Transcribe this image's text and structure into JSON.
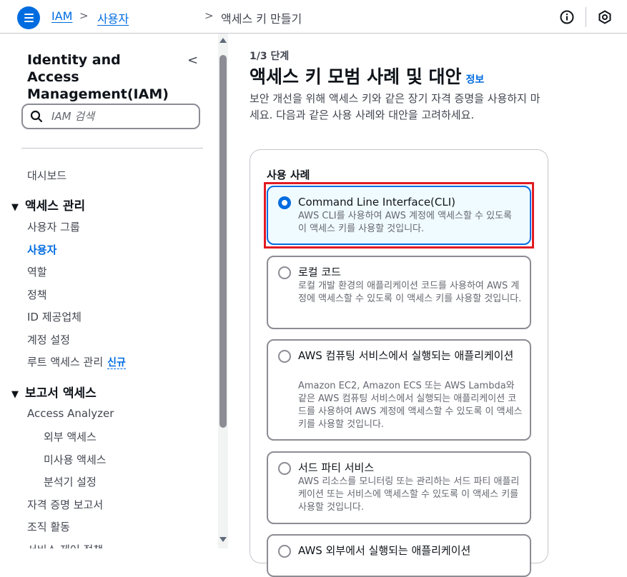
{
  "topbar": {
    "breadcrumbs": [
      {
        "label": "IAM"
      },
      {
        "label": "사용자"
      },
      {
        "label": "액세스 키 만들기"
      }
    ],
    "icons": [
      "menu-icon",
      "info-icon",
      "settings-icon"
    ]
  },
  "sidebar": {
    "title": "Identity and Access Management(IAM)",
    "search_placeholder": "IAM 검색",
    "items": {
      "dashboard": "대시보드",
      "access_mgmt": "액세스 관리",
      "user_groups": "사용자 그룹",
      "users": "사용자",
      "roles": "역할",
      "policies": "정책",
      "id_providers": "ID 제공업체",
      "account_settings": "계정 설정",
      "root_access": "루트 액세스 관리",
      "new_badge": "신규",
      "access_reports": "보고서 액세스",
      "access_analyzer": "Access Analyzer",
      "external_access": "외부 액세스",
      "unused_access": "미사용 액세스",
      "analyzer_settings": "분석기 설정",
      "credential_report": "자격 증명 보고서",
      "org_activity": "조직 활동",
      "scp": "서비스 제어 정책"
    }
  },
  "main": {
    "step": "1/3 단계",
    "title": "액세스 키 모범 사례 및 대안",
    "info": "정보",
    "description": "보안 개선을 위해 액세스 키와 같은 장기 자격 증명을 사용하지 마세요. 다음과 같은 사용 사례와 대안을 고려하세요.",
    "use_case_label": "사용 사례",
    "options": [
      {
        "title": "Command Line Interface(CLI)",
        "desc": "AWS CLI를 사용하여 AWS 계정에 액세스할 수 있도록 이 액세스 키를 사용할 것입니다.",
        "selected": true
      },
      {
        "title": "로컬 코드",
        "desc": "로컬 개발 환경의 애플리케이션 코드를 사용하여 AWS 계정에 액세스할 수 있도록 이 액세스 키를 사용할 것입니다.",
        "selected": false
      },
      {
        "title": "AWS 컴퓨팅 서비스에서 실행되는 애플리케이션",
        "desc": "Amazon EC2, Amazon ECS 또는 AWS Lambda와 같은 AWS 컴퓨팅 서비스에서 실행되는 애플리케이션 코드를 사용하여 AWS 계정에 액세스할 수 있도록 이 액세스 키를 사용할 것입니다.",
        "selected": false
      },
      {
        "title": "서드 파티 서비스",
        "desc": "AWS 리소스를 모니터링 또는 관리하는 서드 파티 애플리케이션 또는 서비스에 액세스할 수 있도록 이 액세스 키를 사용할 것입니다.",
        "selected": false
      },
      {
        "title": "AWS 외부에서 실행되는 애플리케이션",
        "desc": "",
        "selected": false
      }
    ]
  },
  "colors": {
    "accent": "#006ce0",
    "highlight": "#e21b22"
  }
}
